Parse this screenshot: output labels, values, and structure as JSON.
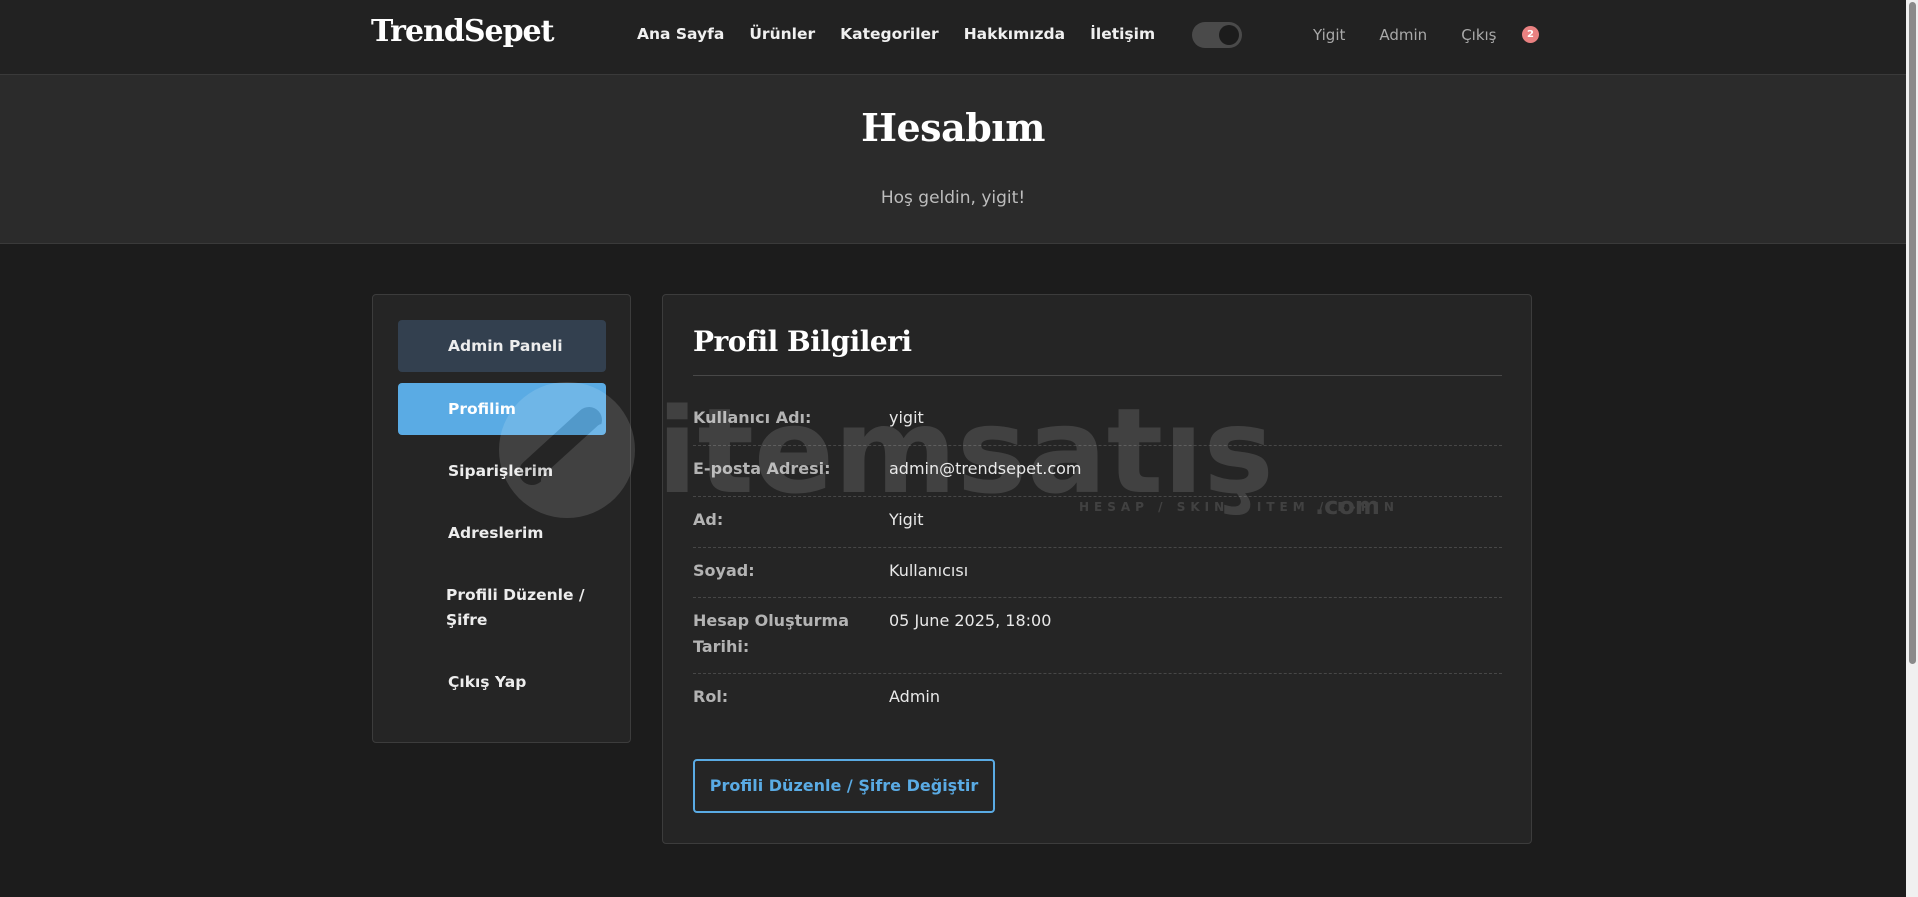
{
  "navbar": {
    "brand": "TrendSepet",
    "links": [
      "Ana Sayfa",
      "Ürünler",
      "Kategoriler",
      "Hakkımızda",
      "İletişim"
    ],
    "user_links": [
      "Yigit",
      "Admin",
      "Çıkış"
    ],
    "badge_count": "2",
    "theme_toggle": "on"
  },
  "hero": {
    "title": "Hesabım",
    "subtitle": "Hoş geldin, yigit!"
  },
  "sidebar": {
    "items": [
      {
        "label": "Admin Paneli",
        "state": "admin"
      },
      {
        "label": "Profilim",
        "state": "active"
      },
      {
        "label": "Siparişlerim",
        "state": "default"
      },
      {
        "label": "Adreslerim",
        "state": "default"
      },
      {
        "label": "Profili Düzenle /\nŞifre",
        "state": "default"
      },
      {
        "label": "Çıkış Yap",
        "state": "default"
      }
    ]
  },
  "profile": {
    "title": "Profil Bilgileri",
    "rows": [
      {
        "label": "Kullanıcı Adı:",
        "value": "yigit"
      },
      {
        "label": "E-posta Adresi:",
        "value": "admin@trendsepet.com"
      },
      {
        "label": "Ad:",
        "value": "Yigit"
      },
      {
        "label": "Soyad:",
        "value": "Kullanıcısı"
      },
      {
        "label": "Hesap Oluşturma Tarihi:",
        "value": "05 June 2025, 18:00"
      },
      {
        "label": "Rol:",
        "value": "Admin"
      }
    ],
    "button_label": "Profili Düzenle / Şifre Değiştir"
  },
  "watermark": {
    "brand": "itemsatış",
    "tagline": "HESAP / SKIN / ITEM / E-PIN",
    "suffix": ".com"
  },
  "colors": {
    "accent": "#5aabe4",
    "admin_button": "#33404f",
    "badge": "#e98181",
    "background": "#1c1c1c",
    "card": "#252525"
  }
}
